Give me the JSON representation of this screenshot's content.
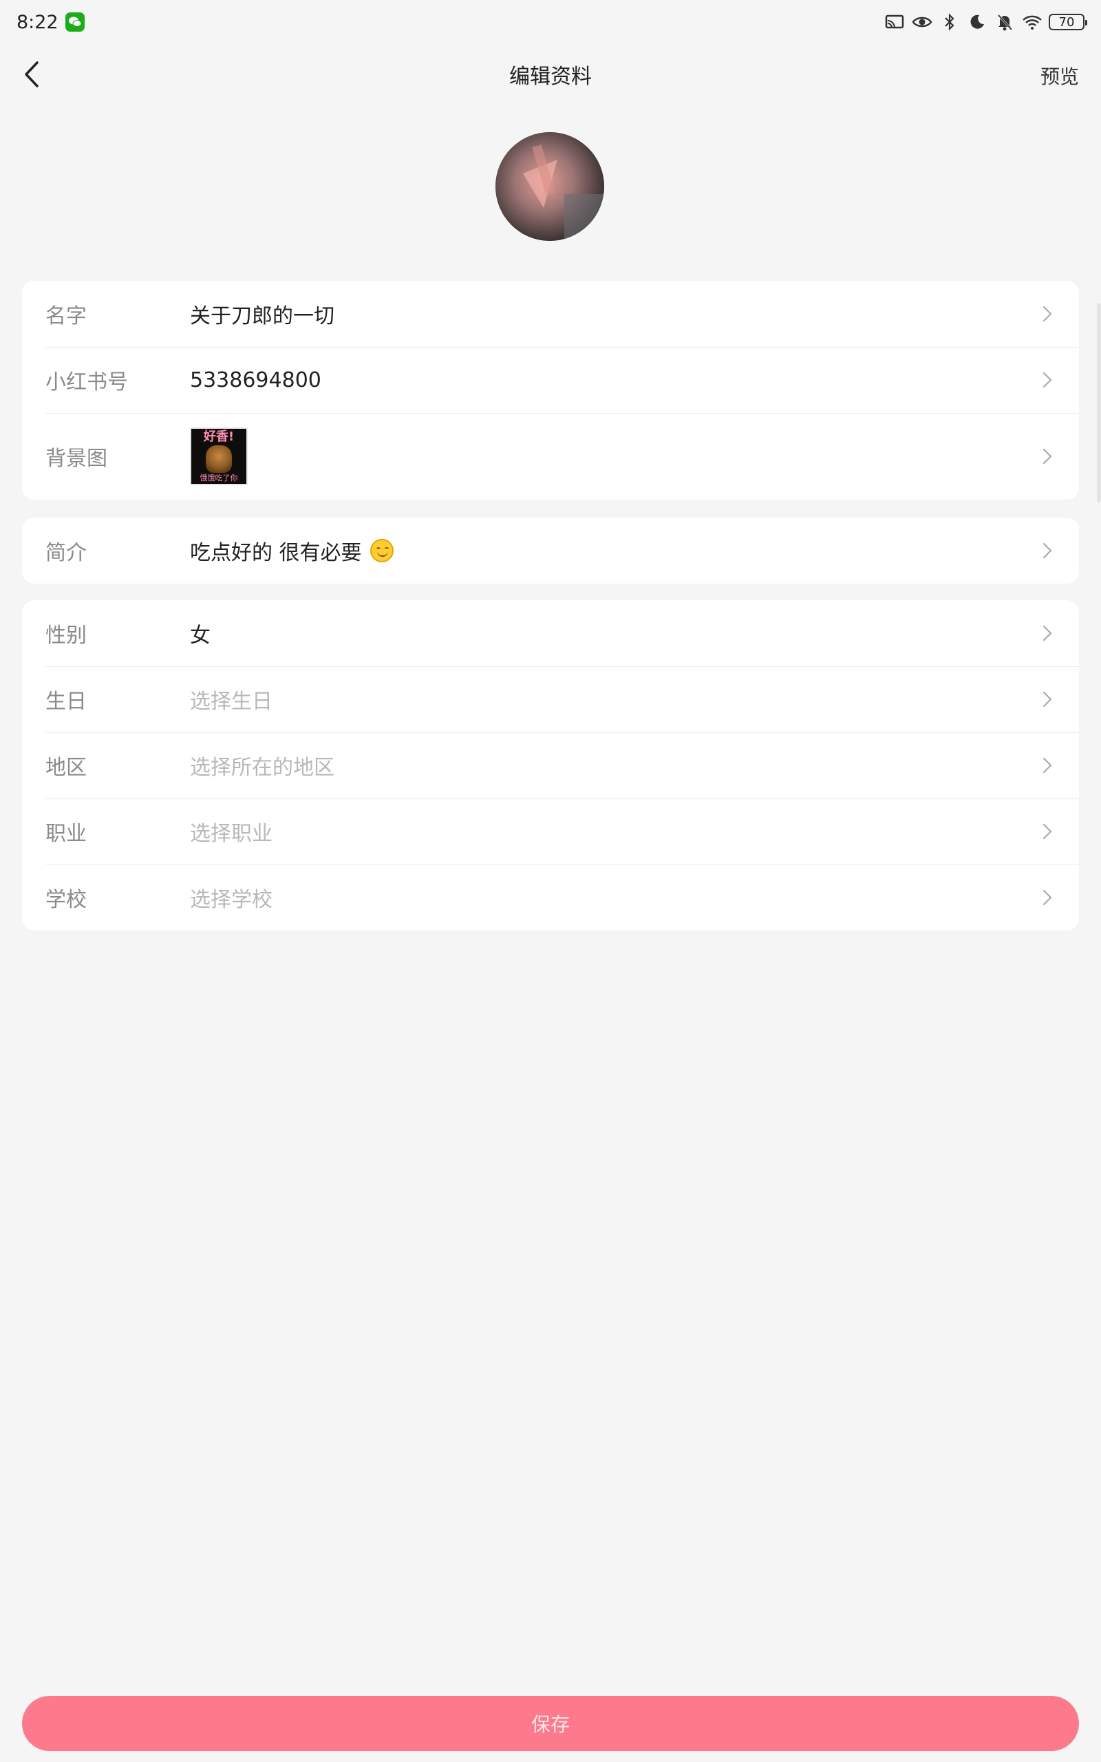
{
  "status_bar": {
    "time": "8:22",
    "battery": "70",
    "icons": [
      "wechat-icon",
      "cast-icon",
      "eye-icon",
      "bluetooth-icon",
      "moon-icon",
      "bell-off-icon",
      "wifi-icon",
      "battery-icon"
    ]
  },
  "nav": {
    "title": "编辑资料",
    "preview": "预览"
  },
  "profile_card": {
    "rows": [
      {
        "label": "名字",
        "value": "关于刀郎的一切"
      },
      {
        "label": "小红书号",
        "value": "5338694800"
      },
      {
        "label": "背景图",
        "thumb_top": "好香!",
        "thumb_bottom": "饿饿吃了你"
      }
    ]
  },
  "bio_card": {
    "label": "简介",
    "value": "吃点好的 很有必要"
  },
  "info_card": {
    "rows": [
      {
        "label": "性别",
        "value": "女"
      },
      {
        "label": "生日",
        "placeholder": "选择生日"
      },
      {
        "label": "地区",
        "placeholder": "选择所在的地区"
      },
      {
        "label": "职业",
        "placeholder": "选择职业"
      },
      {
        "label": "学校",
        "placeholder": "选择学校"
      }
    ]
  },
  "save_button": "保存",
  "colors": {
    "accent": "#fc7a8c",
    "background": "#f5f5f5",
    "placeholder": "#b8b8b8",
    "label": "#8a8a8a"
  }
}
